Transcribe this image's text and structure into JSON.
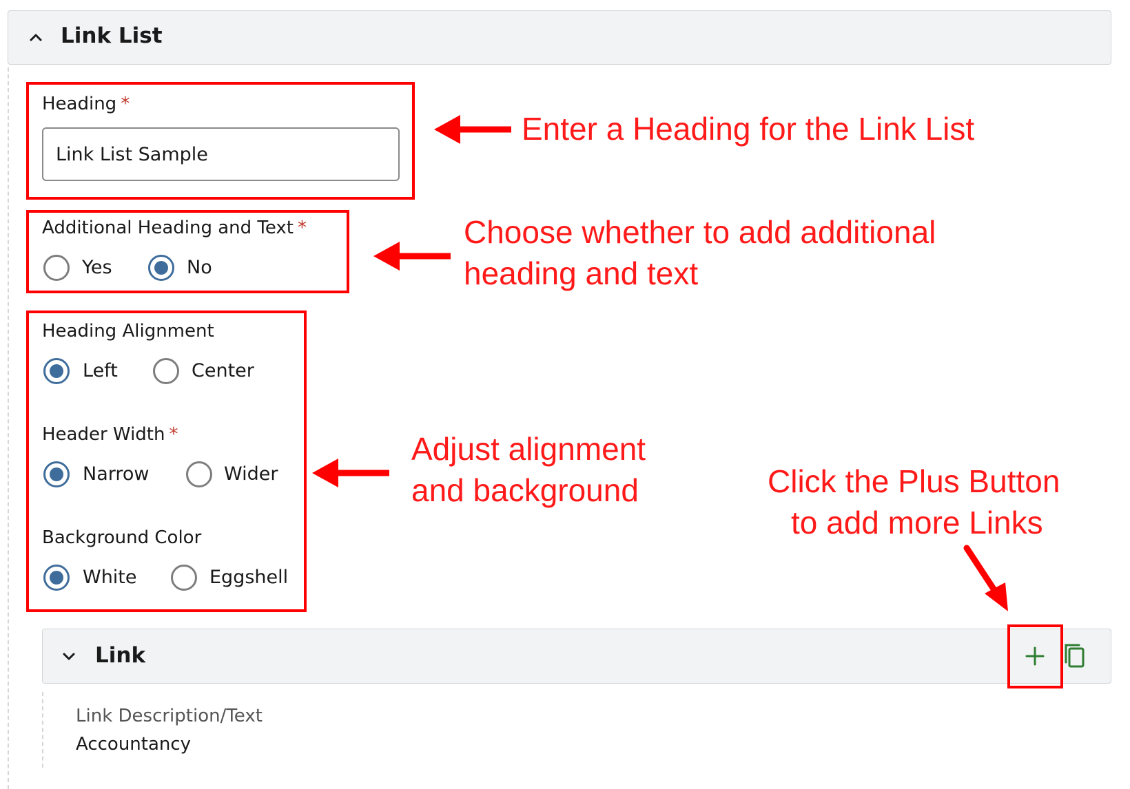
{
  "section": {
    "title": "Link List"
  },
  "heading_field": {
    "label": "Heading",
    "required_mark": "*",
    "value": "Link List Sample"
  },
  "additional_field": {
    "label": "Additional Heading and Text",
    "required_mark": "*",
    "options": [
      {
        "label": "Yes",
        "selected": false
      },
      {
        "label": "No",
        "selected": true
      }
    ]
  },
  "alignment_field": {
    "label": "Heading Alignment",
    "options": [
      {
        "label": "Left",
        "selected": true
      },
      {
        "label": "Center",
        "selected": false
      }
    ]
  },
  "width_field": {
    "label": "Header Width",
    "required_mark": "*",
    "options": [
      {
        "label": "Narrow",
        "selected": true
      },
      {
        "label": "Wider",
        "selected": false
      }
    ]
  },
  "bg_field": {
    "label": "Background Color",
    "options": [
      {
        "label": "White",
        "selected": true
      },
      {
        "label": "Eggshell",
        "selected": false
      }
    ]
  },
  "link_section": {
    "title": "Link",
    "description_label": "Link Description/Text",
    "description_value": "Accountancy"
  },
  "annotations": {
    "heading_note": "Enter a Heading for the Link List",
    "additional_note_line1": "Choose whether to add additional",
    "additional_note_line2": "heading and text",
    "alignment_note_line1": "Adjust alignment",
    "alignment_note_line2": "and background",
    "plus_note_line1": "Click the Plus Button",
    "plus_note_line2": "to add more Links"
  },
  "colors": {
    "annotation_red": "#ff0000",
    "radio_selected": "#3f6d9b",
    "plus_green": "#2e7d32",
    "required_star": "#c0392b"
  },
  "icons": {
    "section_toggle": "chevron-up-icon",
    "link_toggle": "chevron-down-icon",
    "add": "plus-icon",
    "duplicate": "copy-icon"
  }
}
